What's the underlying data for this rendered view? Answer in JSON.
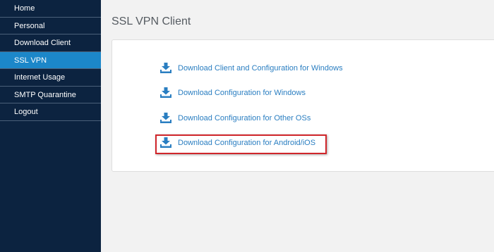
{
  "sidebar": {
    "items": [
      {
        "label": "Home",
        "active": false
      },
      {
        "label": "Personal",
        "active": false
      },
      {
        "label": "Download Client",
        "active": false
      },
      {
        "label": "SSL VPN",
        "active": true
      },
      {
        "label": "Internet Usage",
        "active": false
      },
      {
        "label": "SMTP Quarantine",
        "active": false
      },
      {
        "label": "Logout",
        "active": false
      }
    ]
  },
  "main": {
    "title": "SSL VPN Client",
    "links": [
      {
        "label": "Download Client and Configuration for Windows",
        "icon": "download-icon"
      },
      {
        "label": "Download Configuration for Windows",
        "icon": "download-icon"
      },
      {
        "label": "Download Configuration for Other OSs",
        "icon": "download-icon"
      },
      {
        "label": "Download Configuration for Android/iOS",
        "icon": "download-icon"
      }
    ]
  },
  "colors": {
    "sidebar_bg": "#0c2340",
    "active_item": "#1c87c9",
    "link": "#2a7ec1",
    "highlight": "#d0262b"
  }
}
